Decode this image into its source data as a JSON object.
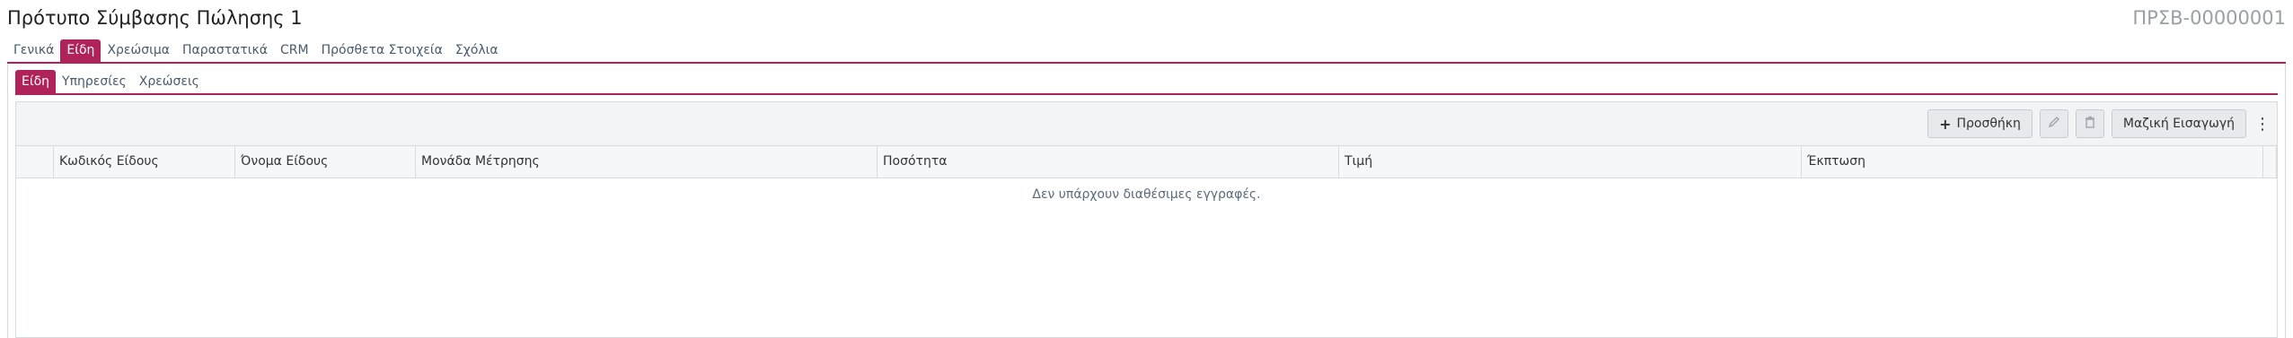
{
  "header": {
    "title": "Πρότυπο Σύμβασης Πώλησης 1",
    "code": "ΠΡΣΒ-00000001"
  },
  "main_tabs": [
    {
      "label": "Γενικά",
      "active": false
    },
    {
      "label": "Είδη",
      "active": true
    },
    {
      "label": "Χρεώσιμα",
      "active": false
    },
    {
      "label": "Παραστατικά",
      "active": false
    },
    {
      "label": "CRM",
      "active": false
    },
    {
      "label": "Πρόσθετα Στοιχεία",
      "active": false
    },
    {
      "label": "Σχόλια",
      "active": false
    }
  ],
  "sub_tabs": [
    {
      "label": "Είδη",
      "active": true
    },
    {
      "label": "Υπηρεσίες",
      "active": false
    },
    {
      "label": "Χρεώσεις",
      "active": false
    }
  ],
  "toolbar": {
    "add_label": "Προσθήκη",
    "bulk_insert_label": "Μαζική Εισαγωγή"
  },
  "table": {
    "columns": [
      "Κωδικός Είδους",
      "Όνομα Είδους",
      "Μονάδα Μέτρησης",
      "Ποσότητα",
      "Τιμή",
      "Έκπτωση"
    ],
    "empty_text": "Δεν υπάρχουν διαθέσιμες εγγραφές."
  },
  "colors": {
    "accent": "#b0225a"
  }
}
